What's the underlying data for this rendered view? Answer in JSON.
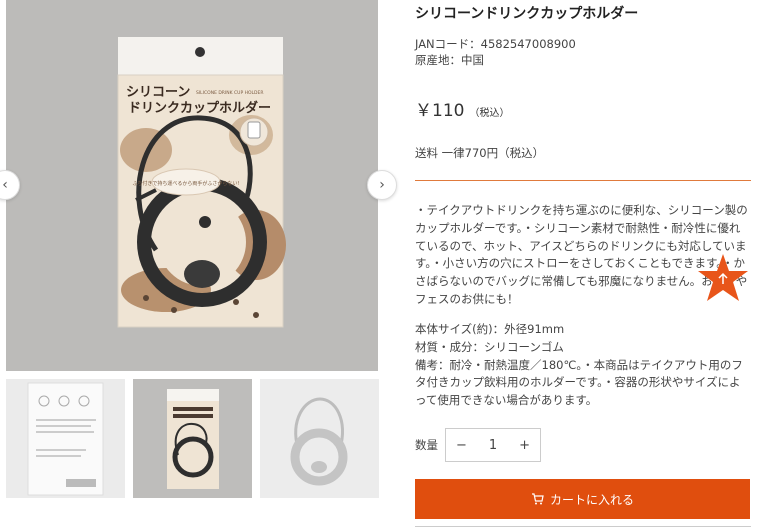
{
  "gallery": {
    "prev_icon": "‹",
    "next_icon": "›",
    "package": {
      "title_line1": "シリコーン",
      "title_en": "SILICONE DRINK CUP HOLDER",
      "title_line2": "ドリンクカップホルダー",
      "bubble": "ふち付きで持ち運べるから両手がふさがらない!"
    }
  },
  "product": {
    "title": "シリコーンドリンクカップホルダー",
    "jan": "JANコード：4582547008900",
    "origin": "原産地：中国",
    "price": "￥110",
    "price_tax": "（税込）",
    "shipping": "送料 一律770円（税込）",
    "description": "・テイクアウトドリンクを持ち運ぶのに便利な、シリコーン製のカップホルダーです。・シリコーン素材で耐熱性・耐冷性に優れているので、ホット、アイスどちらのドリンクにも対応しています。・小さい方の穴にストローをさしておくこともできます。・かさばらないのでバッグに常備しても邪魔になりません。お祭りやフェスのお供にも！",
    "specs": "本体サイズ(約)：外径91mm\n材質・成分：シリコーンゴム\n備考：耐冷・耐熱温度／180℃。・本商品はテイクアウト用のフタ付きカップ飲料用のホルダーです。・容器の形状やサイズによって使用できない場合があります。",
    "qty_label": "数量",
    "qty_value": "1",
    "qty_minus": "−",
    "qty_plus": "+",
    "cart_label": "カートに入れる"
  },
  "colors": {
    "accent": "#e04e0e",
    "divider": "#e07a3c",
    "star": "#e8551a"
  }
}
